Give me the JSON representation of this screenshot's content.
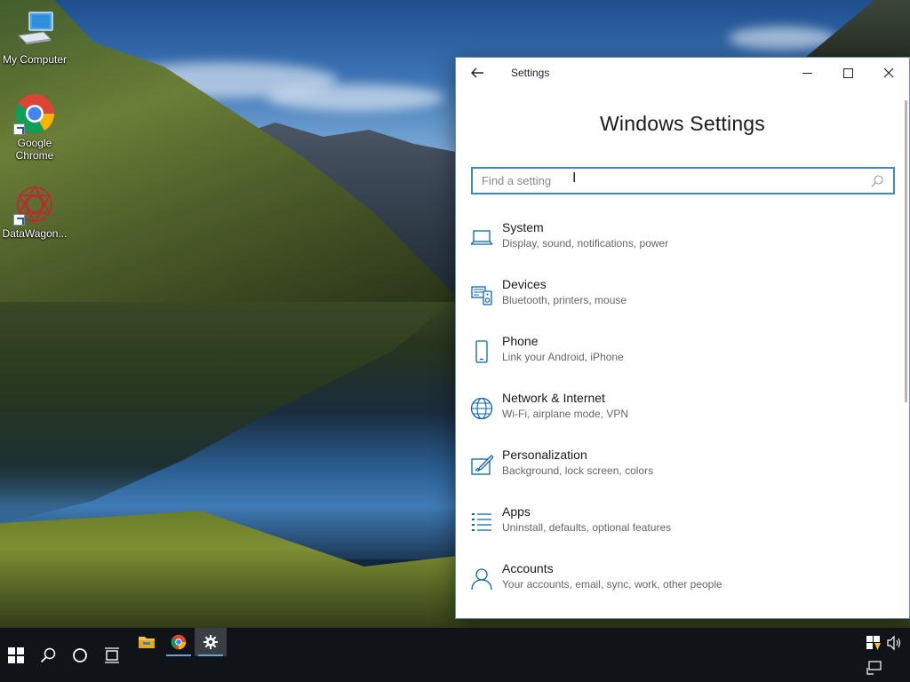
{
  "desktop": {
    "icons": [
      {
        "label": "My Computer",
        "icon": "computer-icon"
      },
      {
        "label": "Google Chrome",
        "icon": "chrome-icon"
      },
      {
        "label": "DataWagon...",
        "icon": "datawagon-icon"
      }
    ]
  },
  "window": {
    "title": "Settings",
    "back_icon": "back-arrow-icon",
    "heading": "Windows Settings",
    "search": {
      "placeholder": "Find a setting",
      "value": ""
    },
    "items": [
      {
        "title": "System",
        "subtitle": "Display, sound, notifications, power",
        "icon": "laptop-icon"
      },
      {
        "title": "Devices",
        "subtitle": "Bluetooth, printers, mouse",
        "icon": "devices-icon"
      },
      {
        "title": "Phone",
        "subtitle": "Link your Android, iPhone",
        "icon": "phone-icon"
      },
      {
        "title": "Network & Internet",
        "subtitle": "Wi-Fi, airplane mode, VPN",
        "icon": "globe-icon"
      },
      {
        "title": "Personalization",
        "subtitle": "Background, lock screen, colors",
        "icon": "paint-icon"
      },
      {
        "title": "Apps",
        "subtitle": "Uninstall, defaults, optional features",
        "icon": "apps-list-icon"
      },
      {
        "title": "Accounts",
        "subtitle": "Your accounts, email, sync, work, other people",
        "icon": "person-icon"
      }
    ]
  },
  "taskbar": {
    "buttons": [
      "start-icon",
      "search-icon",
      "cortana-icon",
      "task-view-icon"
    ],
    "apps": [
      "file-explorer-icon",
      "chrome-icon",
      "settings-gear-icon"
    ],
    "tray": [
      "security-shield-icon",
      "volume-icon",
      "network-icon"
    ]
  },
  "colors": {
    "accent": "#0a64b2",
    "search_border": "#3b8ac4",
    "taskbar": "#101419"
  }
}
